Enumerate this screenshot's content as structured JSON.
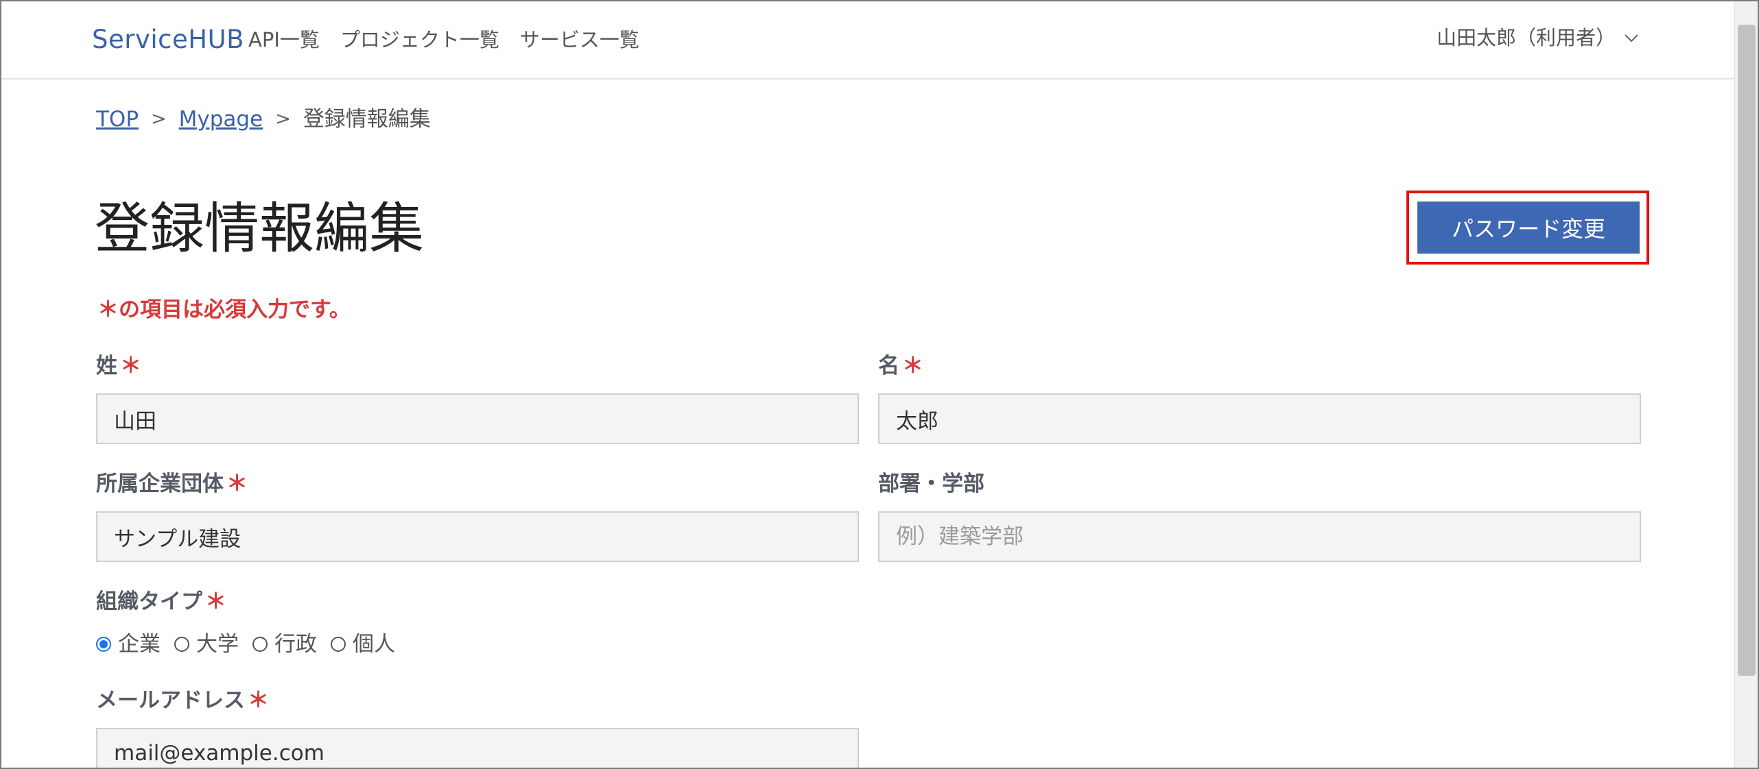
{
  "header": {
    "brand": "ServiceHUB",
    "nav": [
      "API一覧",
      "プロジェクト一覧",
      "サービス一覧"
    ],
    "user_menu": "山田太郎（利用者）"
  },
  "breadcrumb": {
    "top": "TOP",
    "mypage": "Mypage",
    "current": "登録情報編集",
    "separator": ">"
  },
  "page": {
    "title": "登録情報編集",
    "password_button": "パスワード変更",
    "required_note": "＊の項目は必須入力です。"
  },
  "form": {
    "required_mark": "＊",
    "last_name": {
      "label": "姓",
      "value": "山田"
    },
    "first_name": {
      "label": "名",
      "value": "太郎"
    },
    "company": {
      "label": "所属企業団体",
      "value": "サンプル建設"
    },
    "department": {
      "label": "部署・学部",
      "value": "",
      "placeholder": "例）建築学部"
    },
    "org_type": {
      "label": "組織タイプ",
      "options": [
        "企業",
        "大学",
        "行政",
        "個人"
      ],
      "selected": "企業"
    },
    "email": {
      "label": "メールアドレス",
      "value": "mail@example.com"
    }
  },
  "colors": {
    "brand": "#3a61a8",
    "primary_button": "#3f68b4",
    "required": "#d63a3a",
    "highlight": "#e01010"
  }
}
